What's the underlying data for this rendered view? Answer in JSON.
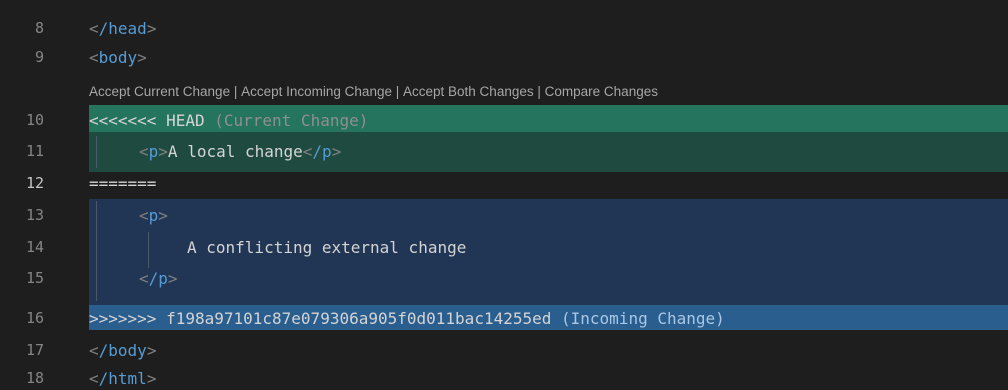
{
  "editor": {
    "lines": [
      {
        "num": "8",
        "tag": "/head"
      },
      {
        "num": "9",
        "tag": "body"
      },
      {
        "num": "10",
        "marker": "<<<<<<< HEAD",
        "label": "(Current Change)"
      },
      {
        "num": "11",
        "open": "p",
        "text": "A local change",
        "close": "/p"
      },
      {
        "num": "12",
        "marker": "======="
      },
      {
        "num": "13",
        "open": "p"
      },
      {
        "num": "14",
        "text": "A conflicting external change"
      },
      {
        "num": "15",
        "close": "/p"
      },
      {
        "num": "16",
        "marker": ">>>>>>> f198a97101c87e079306a905f0d011bac14255ed",
        "label": "(Incoming Change)"
      },
      {
        "num": "17",
        "tag": "/body"
      },
      {
        "num": "18",
        "tag": "/html"
      }
    ]
  },
  "codelens": {
    "accept_current": "Accept Current Change",
    "accept_incoming": "Accept Incoming Change",
    "accept_both": "Accept Both Changes",
    "compare": "Compare Changes",
    "separator": "|"
  },
  "colors": {
    "current_header": "#25745e",
    "current_body": "#1f4a40",
    "incoming_body": "#213554",
    "incoming_header": "#2a5e8e",
    "tag": "#569cd6",
    "bracket": "#808080"
  }
}
